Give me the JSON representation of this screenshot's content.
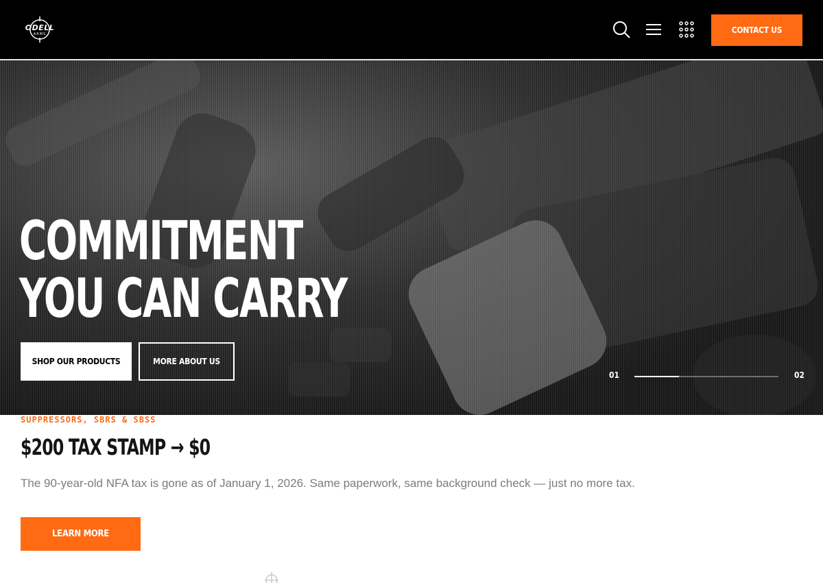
{
  "header": {
    "logo": {
      "text": "ODELL",
      "subtext": "ARMS"
    },
    "icons": [
      "search-icon",
      "menu-icon",
      "grid-icon"
    ],
    "contact_label": "CONTACT US"
  },
  "hero": {
    "title_line1": "COMMITMENT",
    "title_line2": "YOU CAN CARRY",
    "shop_label": "SHOP OUR PRODUCTS",
    "about_label": "MORE ABOUT US",
    "slider": {
      "current": "01",
      "total": "02",
      "progress": 0.31
    }
  },
  "promo": {
    "eyebrow": "SUPPRESSORS, SBRS & SBSS",
    "title": "$200 TAX STAMP → $0",
    "text": "The 90-year-old NFA tax is gone as of January 1, 2026. Same paperwork, same background check — just no more tax.",
    "button_label": "LEARN MORE"
  },
  "colors": {
    "accent": "#ff6a13",
    "header_bg": "#000000",
    "text_dark": "#141414",
    "text_muted": "#7c7c7c"
  }
}
